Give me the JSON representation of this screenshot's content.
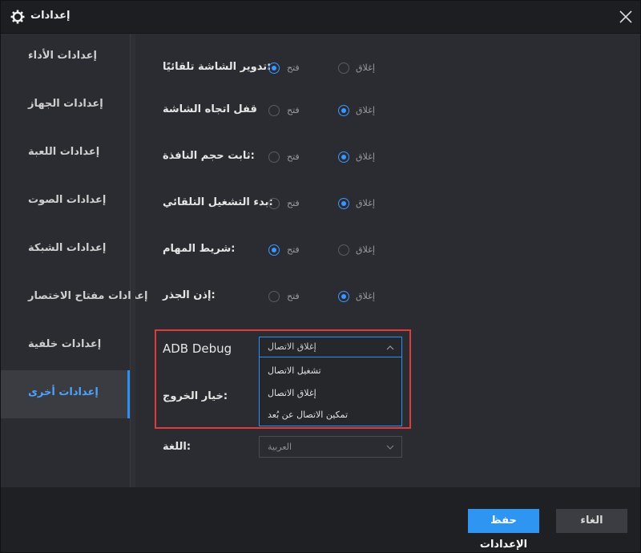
{
  "window": {
    "title": "إعدادات"
  },
  "colors": {
    "accent": "#2e8ff0",
    "highlight": "#e03b3b",
    "background": "#2b2c31"
  },
  "sidebar": {
    "items": [
      {
        "label": "إعدادات الأداء"
      },
      {
        "label": "إعدادات الجهاز"
      },
      {
        "label": "إعدادات اللعبة"
      },
      {
        "label": "إعدادات الصوت"
      },
      {
        "label": "إعدادات الشبكة"
      },
      {
        "label": "إعدادات مفتاح الاختصار"
      },
      {
        "label": "إعدادات خلفية"
      },
      {
        "label": "إعدادات أخرى",
        "active": true
      }
    ]
  },
  "settings": {
    "open_label": "فتح",
    "close_label": "إغلاق",
    "rows": [
      {
        "label": "تدوير الشاشة تلقائيًا:",
        "selected": "open"
      },
      {
        "label": "قفل اتجاه الشاشة",
        "selected": "close"
      },
      {
        "label": "ثابت حجم النافذة:",
        "selected": "close"
      },
      {
        "label": "بدء التشغيل التلقائي:",
        "selected": "close"
      },
      {
        "label": "شريط المهام:",
        "selected": "open"
      },
      {
        "label": "إذن الجذر:",
        "selected": "close"
      }
    ]
  },
  "adb": {
    "label": "ADB Debug",
    "selected": "إغلاق الاتصال",
    "options": [
      "تشغيل الاتصال",
      "إغلاق الاتصال",
      "تمكين الاتصال عن بُعد"
    ]
  },
  "exit": {
    "label": "خيار الخروج:"
  },
  "language": {
    "label": "اللغة:",
    "selected": "العربية"
  },
  "footer": {
    "save_label": "حفظ الإعدادات",
    "cancel_label": "الغاء"
  },
  "icons": {
    "settings": "gear-icon",
    "close": "close-icon",
    "dropdown": "chevron-icon"
  }
}
